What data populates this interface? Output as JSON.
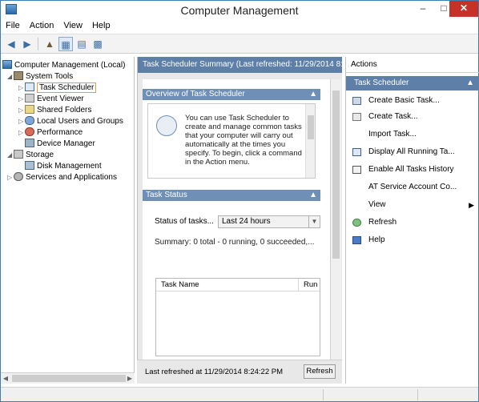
{
  "window": {
    "title": "Computer Management"
  },
  "menu": {
    "items": [
      "File",
      "Action",
      "View",
      "Help"
    ]
  },
  "tree": {
    "root": "Computer Management (Local)",
    "system_tools": "System Tools",
    "task_scheduler": "Task Scheduler",
    "event_viewer": "Event Viewer",
    "shared_folders": "Shared Folders",
    "local_users": "Local Users and Groups",
    "performance": "Performance",
    "device_manager": "Device Manager",
    "storage": "Storage",
    "disk_management": "Disk Management",
    "services_apps": "Services and Applications"
  },
  "middle": {
    "header": "Task Scheduler Summary (Last refreshed: 11/29/2014 8:...",
    "overview_heading": "Overview of Task Scheduler",
    "overview_text": "You can use Task Scheduler to create and manage common tasks that your computer will carry out automatically at the times you specify. To begin, click a command in the Action menu.",
    "task_status_heading": "Task Status",
    "status_label": "Status of tasks...",
    "status_value": "Last 24 hours",
    "status_summary": "Summary: 0 total - 0 running, 0 succeeded,...",
    "table_headers": {
      "name": "Task Name",
      "run": "Run"
    },
    "refresh_text": "Last refreshed at 11/29/2014 8:24:22 PM",
    "refresh_button": "Refresh"
  },
  "actions": {
    "header": "Actions",
    "section": "Task Scheduler",
    "items": {
      "basic": "Create Basic Task...",
      "create": "Create Task...",
      "import": "Import Task...",
      "display": "Display All Running Ta...",
      "history": "Enable All Tasks History",
      "at": "AT Service Account Co...",
      "view": "View",
      "refresh": "Refresh",
      "help": "Help"
    }
  }
}
